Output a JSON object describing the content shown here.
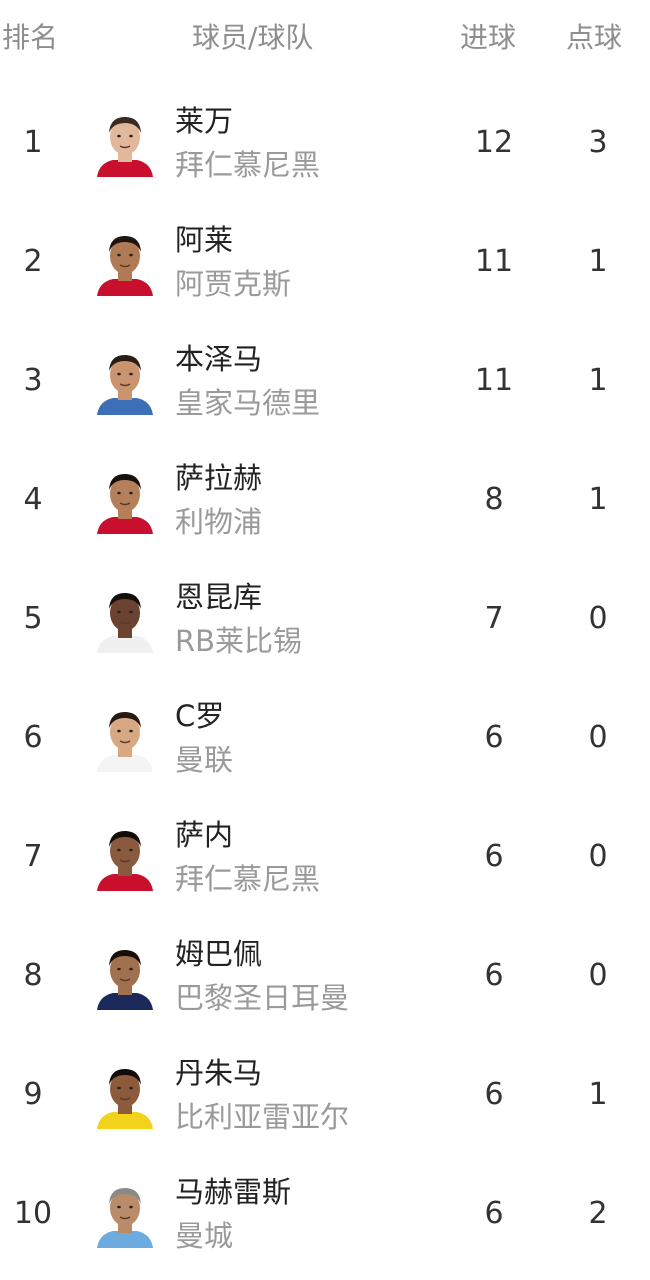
{
  "header": {
    "rank": "排名",
    "player_team": "球员/球队",
    "goals": "进球",
    "penalties": "点球"
  },
  "rows": [
    {
      "rank": "1",
      "player": "莱万",
      "team": "拜仁慕尼黑",
      "goals": "12",
      "penalties": "3",
      "avatar_icon": "player-avatar-icon",
      "skin": "#e2b89a",
      "hair": "#3a2a20",
      "kit": "#c8102e"
    },
    {
      "rank": "2",
      "player": "阿莱",
      "team": "阿贾克斯",
      "goals": "11",
      "penalties": "1",
      "avatar_icon": "player-avatar-icon",
      "skin": "#b07a55",
      "hair": "#1e1410",
      "kit": "#c8102e"
    },
    {
      "rank": "3",
      "player": "本泽马",
      "team": "皇家马德里",
      "goals": "11",
      "penalties": "1",
      "avatar_icon": "player-avatar-icon",
      "skin": "#c9946e",
      "hair": "#2a1d15",
      "kit": "#3d6fb8"
    },
    {
      "rank": "4",
      "player": "萨拉赫",
      "team": "利物浦",
      "goals": "8",
      "penalties": "1",
      "avatar_icon": "player-avatar-icon",
      "skin": "#b57f5a",
      "hair": "#17100c",
      "kit": "#c8102e"
    },
    {
      "rank": "5",
      "player": "恩昆库",
      "team": "RB莱比锡",
      "goals": "7",
      "penalties": "0",
      "avatar_icon": "player-avatar-icon",
      "skin": "#6b4330",
      "hair": "#150e0a",
      "kit": "#f0f0f0"
    },
    {
      "rank": "6",
      "player": "C罗",
      "team": "曼联",
      "goals": "6",
      "penalties": "0",
      "avatar_icon": "player-avatar-icon",
      "skin": "#d8a883",
      "hair": "#241810",
      "kit": "#f4f4f4"
    },
    {
      "rank": "7",
      "player": "萨内",
      "team": "拜仁慕尼黑",
      "goals": "6",
      "penalties": "0",
      "avatar_icon": "player-avatar-icon",
      "skin": "#8a5a3e",
      "hair": "#120c08",
      "kit": "#c8102e"
    },
    {
      "rank": "8",
      "player": "姆巴佩",
      "team": "巴黎圣日耳曼",
      "goals": "6",
      "penalties": "0",
      "avatar_icon": "player-avatar-icon",
      "skin": "#a0704f",
      "hair": "#150e0a",
      "kit": "#1b2a5a"
    },
    {
      "rank": "9",
      "player": "丹朱马",
      "team": "比利亚雷亚尔",
      "goals": "6",
      "penalties": "1",
      "avatar_icon": "player-avatar-icon",
      "skin": "#8e5a3c",
      "hair": "#120c08",
      "kit": "#f3d21b"
    },
    {
      "rank": "10",
      "player": "马赫雷斯",
      "team": "曼城",
      "goals": "6",
      "penalties": "2",
      "avatar_icon": "player-avatar-icon",
      "skin": "#b98b68",
      "hair": "#8a8a8a",
      "kit": "#6cabdd"
    }
  ]
}
